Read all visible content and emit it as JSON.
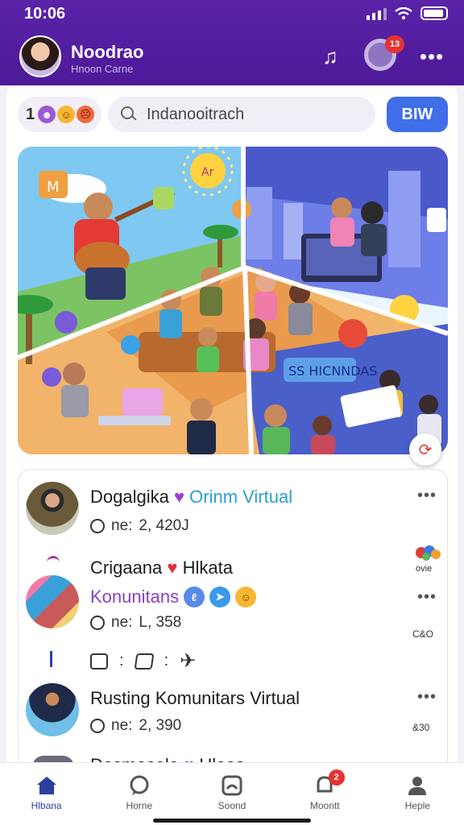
{
  "status_bar": {
    "time": "10:06"
  },
  "header": {
    "name": "Noodrao",
    "subtitle": "Hnoon Carne",
    "notification_count": "13"
  },
  "toolbar": {
    "reaction_count": "1",
    "search_text": "Indanooitrach",
    "action_label": "BIW"
  },
  "hero": {
    "sign_left": "M",
    "sun_label": "Ar",
    "banner_text": "SS HICNNDAS"
  },
  "posts": [
    {
      "title": "Dogalgika",
      "title_accent": "Orinm Virtual",
      "meta_label": "ne:",
      "meta_value": "2, 420J"
    },
    {
      "title": "Crigaana",
      "title_after": "Hlkata",
      "subtitle": "Konunitans",
      "meta_label": "ne:",
      "meta_value": "L, 358",
      "side_tag": "ovie",
      "side_note": "C&O",
      "actions": [
        ":",
        ":"
      ]
    },
    {
      "title": "Rusting Komunitars Virtual",
      "meta_label": "ne:",
      "meta_value": "2, 390",
      "side_note": "&30"
    },
    {
      "title": "Dasmaselo",
      "title_after": "Ulaas"
    }
  ],
  "bottom_nav": [
    {
      "label": "Hlbana",
      "icon": "home-icon",
      "active": true
    },
    {
      "label": "Horne",
      "icon": "chat-bubble-icon",
      "active": false
    },
    {
      "label": "Soond",
      "icon": "image-icon",
      "active": false
    },
    {
      "label": "Moontt",
      "icon": "notification-icon",
      "active": false,
      "badge": "2"
    },
    {
      "label": "Heple",
      "icon": "profile-icon",
      "active": false
    }
  ],
  "colors": {
    "header_purple": "#5a23a8",
    "accent_blue": "#3f6ee8",
    "title_accent": "#2a9ed4",
    "subtitle_purple": "#8a3fc4",
    "badge_red": "#e63232"
  }
}
